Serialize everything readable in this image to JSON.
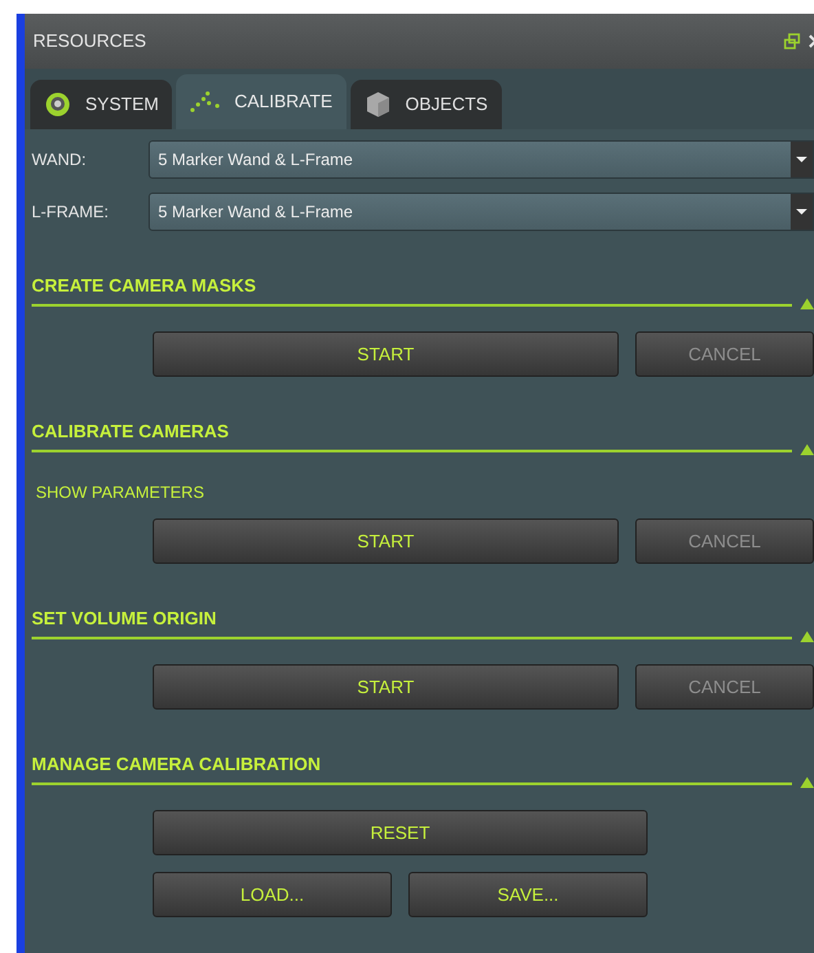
{
  "panel": {
    "title": "RESOURCES"
  },
  "tabs": [
    {
      "label": "SYSTEM",
      "selected": false
    },
    {
      "label": "CALIBRATE",
      "selected": true
    },
    {
      "label": "OBJECTS",
      "selected": false
    }
  ],
  "fields": [
    {
      "label": "WAND:",
      "value": "5 Marker Wand & L-Frame"
    },
    {
      "label": "L-FRAME:",
      "value": "5 Marker Wand & L-Frame"
    }
  ],
  "sections": [
    {
      "title": "CREATE CAMERA MASKS",
      "expanded": true,
      "rows": [
        {
          "kind": "start_cancel",
          "buttons": [
            {
              "label": "START",
              "disabled": false
            },
            {
              "label": "CANCEL",
              "disabled": true
            }
          ]
        }
      ]
    },
    {
      "title": "CALIBRATE CAMERAS",
      "expanded": true,
      "link": "SHOW PARAMETERS",
      "rows": [
        {
          "kind": "start_cancel",
          "buttons": [
            {
              "label": "START",
              "disabled": false
            },
            {
              "label": "CANCEL",
              "disabled": true
            }
          ]
        }
      ]
    },
    {
      "title": "SET VOLUME ORIGIN",
      "expanded": true,
      "rows": [
        {
          "kind": "start_cancel",
          "buttons": [
            {
              "label": "START",
              "disabled": false
            },
            {
              "label": "CANCEL",
              "disabled": true
            }
          ]
        }
      ]
    },
    {
      "title": "MANAGE CAMERA CALIBRATION",
      "expanded": true,
      "rows": [
        {
          "kind": "single",
          "buttons": [
            {
              "label": "RESET",
              "disabled": false
            }
          ]
        },
        {
          "kind": "pair",
          "buttons": [
            {
              "label": "LOAD...",
              "disabled": false
            },
            {
              "label": "SAVE...",
              "disabled": false
            }
          ]
        }
      ]
    }
  ]
}
